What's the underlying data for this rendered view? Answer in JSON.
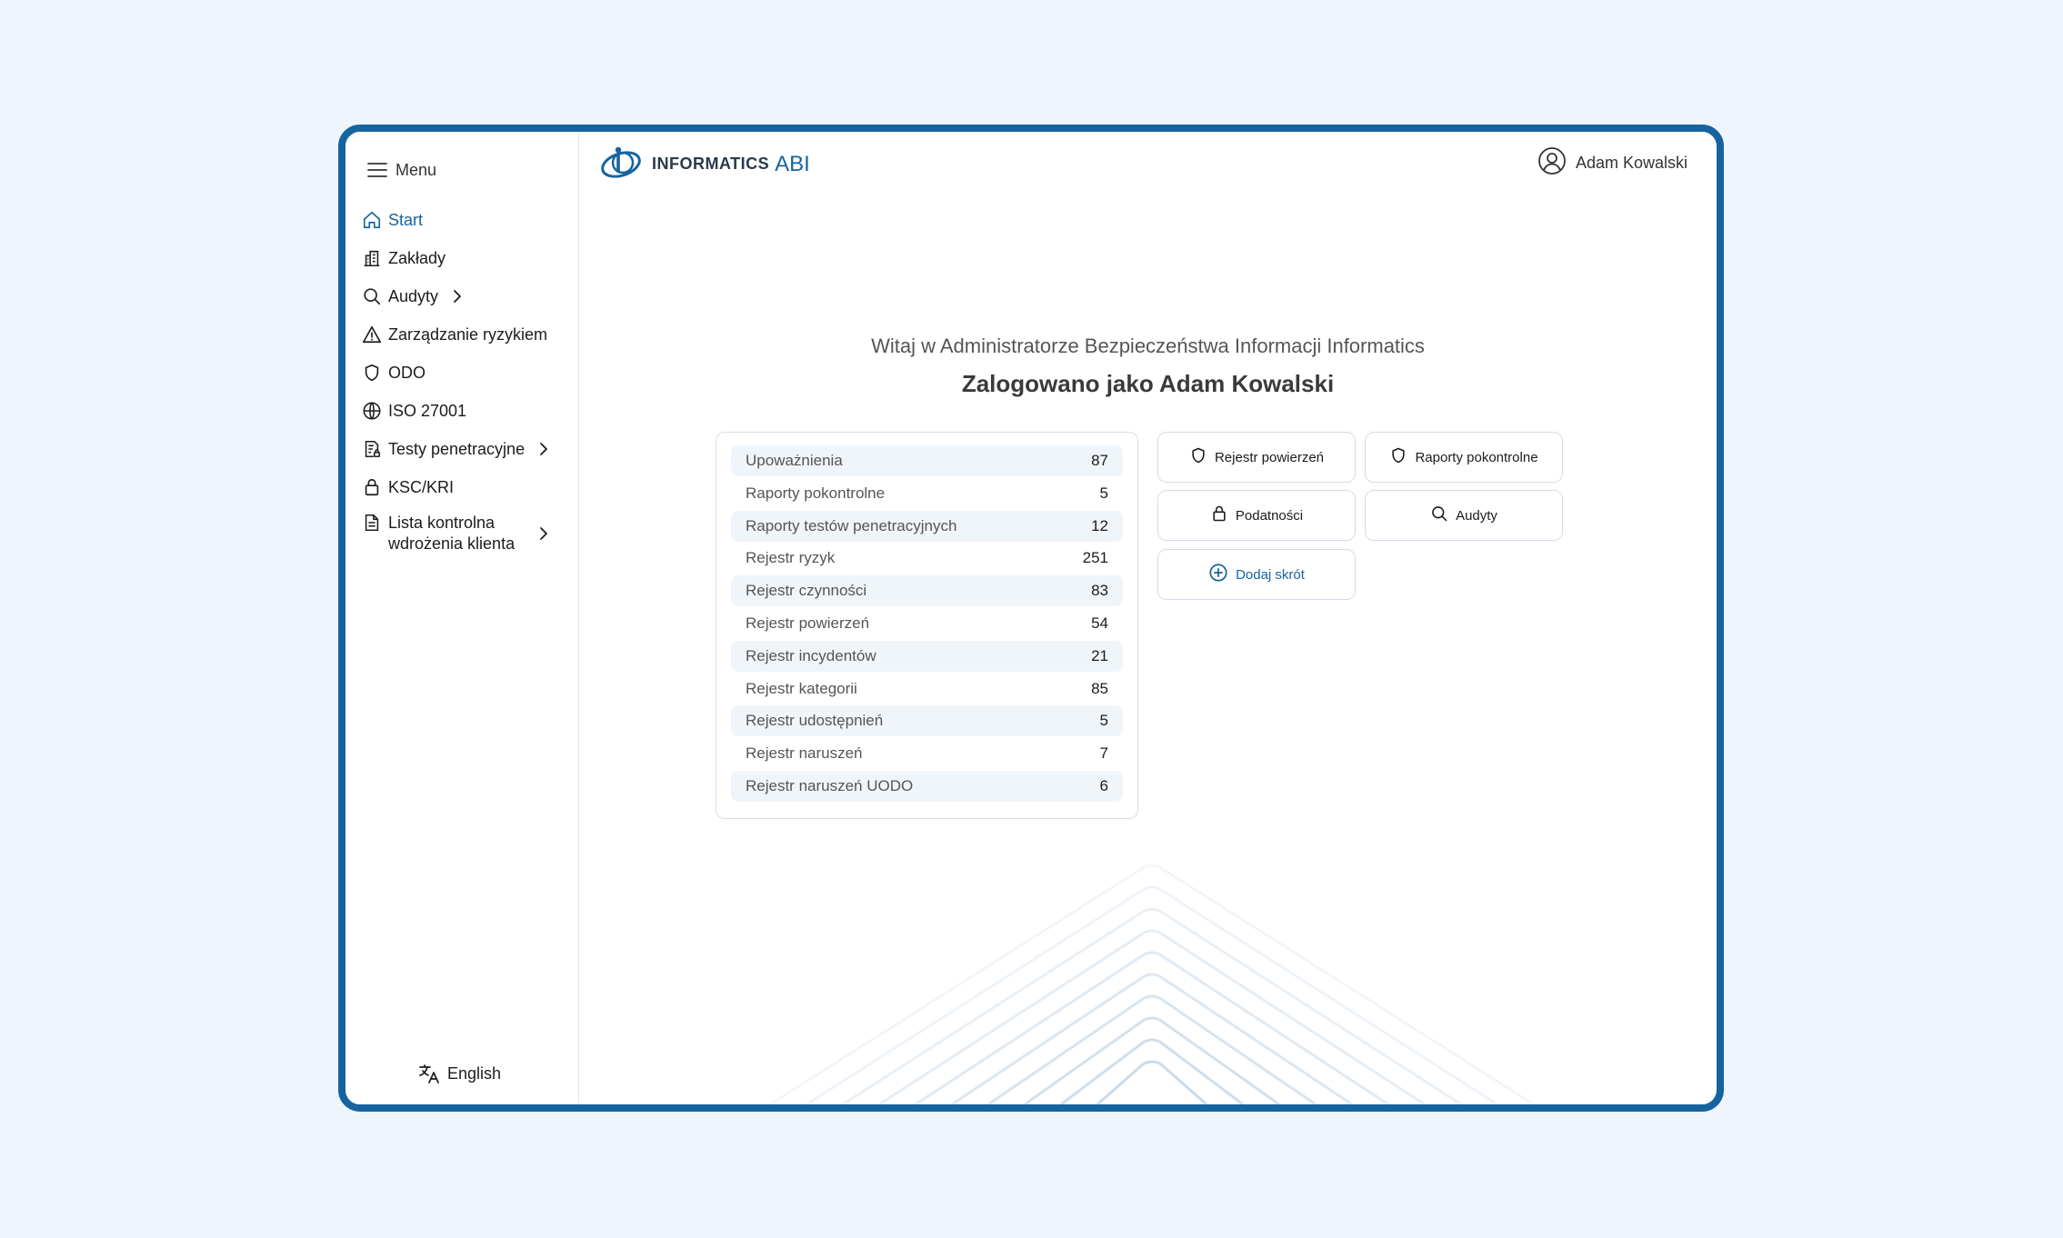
{
  "sidebar": {
    "menu_label": "Menu",
    "items": [
      {
        "label": "Start",
        "icon": "home-icon",
        "active": true
      },
      {
        "label": "Zakłady",
        "icon": "building-icon"
      },
      {
        "label": "Audyty",
        "icon": "search-icon",
        "has_children": true
      },
      {
        "label": "Zarządzanie ryzykiem",
        "icon": "warning-icon"
      },
      {
        "label": "ODO",
        "icon": "shield-icon"
      },
      {
        "label": "ISO 27001",
        "icon": "globe-icon"
      },
      {
        "label": "Testy penetracyjne",
        "icon": "document-lock-icon",
        "has_children": true
      },
      {
        "label": "KSC/KRI",
        "icon": "lock-icon"
      },
      {
        "label": "Lista kontrolna wdrożenia klienta",
        "icon": "document-icon",
        "has_children": true
      }
    ],
    "language_label": "English"
  },
  "header": {
    "logo_text": "INFORMATICS",
    "logo_suffix": "ABI",
    "user_name": "Adam Kowalski"
  },
  "main": {
    "welcome": "Witaj w Administratorze Bezpieczeństwa Informacji Informatics",
    "logged_in": "Zalogowano jako Adam Kowalski",
    "stats": [
      {
        "label": "Upoważnienia",
        "value": "87"
      },
      {
        "label": "Raporty pokontrolne",
        "value": "5"
      },
      {
        "label": "Raporty testów penetracyjnych",
        "value": "12"
      },
      {
        "label": "Rejestr ryzyk",
        "value": "251"
      },
      {
        "label": "Rejestr czynności",
        "value": "83"
      },
      {
        "label": "Rejestr powierzeń",
        "value": "54"
      },
      {
        "label": "Rejestr incydentów",
        "value": "21"
      },
      {
        "label": "Rejestr kategorii",
        "value": "85"
      },
      {
        "label": "Rejestr udostępnień",
        "value": "5"
      },
      {
        "label": "Rejestr naruszeń",
        "value": "7"
      },
      {
        "label": "Rejestr naruszeń UODO",
        "value": "6"
      }
    ],
    "shortcuts": [
      {
        "label": "Rejestr powierzeń",
        "icon": "shield-icon"
      },
      {
        "label": "Raporty pokontrolne",
        "icon": "shield-icon"
      },
      {
        "label": "Podatności",
        "icon": "lock-icon"
      },
      {
        "label": "Audyty",
        "icon": "search-icon"
      }
    ],
    "add_shortcut": "Dodaj skrót"
  },
  "colors": {
    "accent": "#16649f",
    "page_background": "#eef5fc",
    "row_stripe": "#f0f5fa"
  }
}
